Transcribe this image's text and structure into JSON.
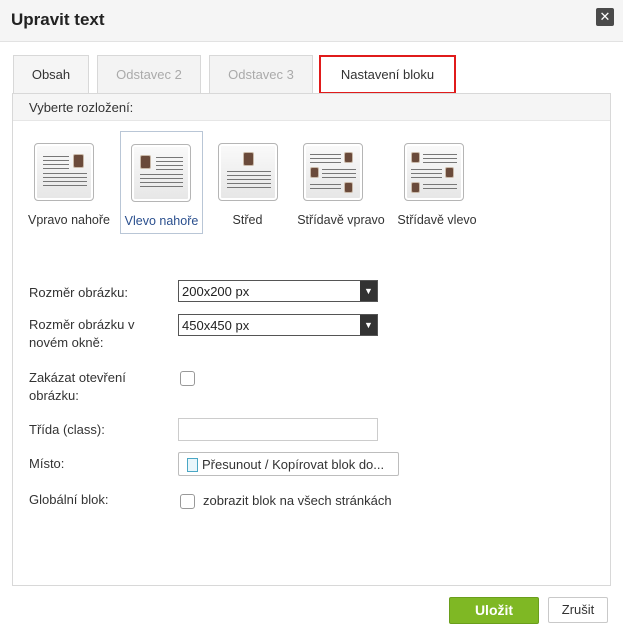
{
  "dialog": {
    "title": "Upravit text",
    "close_icon": "close-icon"
  },
  "tabs": [
    {
      "label": "Obsah",
      "active": true
    },
    {
      "label": "Odstavec 2",
      "active": false
    },
    {
      "label": "Odstavec 3",
      "active": false
    },
    {
      "label": "Nastavení bloku",
      "active": false,
      "highlighted": true
    }
  ],
  "layout": {
    "heading": "Vyberte rozložení:",
    "options": [
      {
        "label": "Vpravo nahoře",
        "icon": "layout-image-top-right-icon",
        "selected": false
      },
      {
        "label": "Vlevo nahoře",
        "icon": "layout-image-top-left-icon",
        "selected": true
      },
      {
        "label": "Střed",
        "icon": "layout-image-center-icon",
        "selected": false
      },
      {
        "label": "Střídavě vpravo",
        "icon": "layout-alternating-right-icon",
        "selected": false
      },
      {
        "label": "Střídavě vlevo",
        "icon": "layout-alternating-left-icon",
        "selected": false
      }
    ]
  },
  "form": {
    "image_size": {
      "label": "Rozměr obrázku:",
      "value": "200x200 px"
    },
    "image_size_new_window": {
      "label": "Rozměr obrázku v novém okně:",
      "value": "450x450 px"
    },
    "disable_open": {
      "label": "Zakázat otevření obrázku:",
      "checked": false
    },
    "css_class": {
      "label": "Třída (class):",
      "value": ""
    },
    "place": {
      "label": "Místo:",
      "button_label": "Přesunout / Kopírovat blok do..."
    },
    "global_block": {
      "label": "Globální blok:",
      "checkbox_label": "zobrazit blok na všech stránkách",
      "checked": false
    }
  },
  "footer": {
    "ok_label": "Uložit",
    "cancel_label": "Zrušit"
  },
  "colors": {
    "accent_green": "#7fb824",
    "highlight_red": "#e01b1b"
  }
}
